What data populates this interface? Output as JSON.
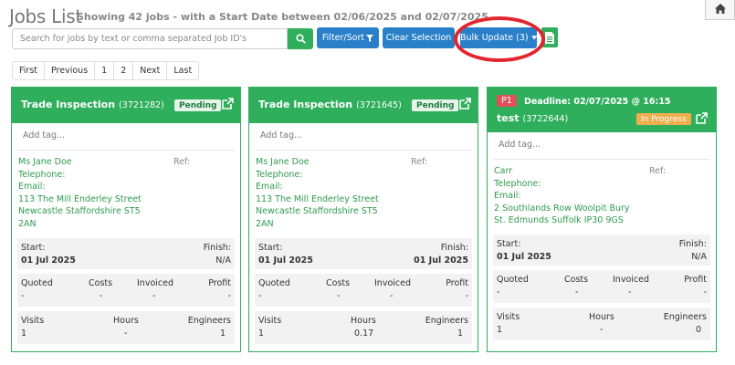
{
  "header": {
    "title": "Jobs List",
    "subtitle": "Showing 42 jobs - with a Start Date between 02/06/2025 and 02/07/2025"
  },
  "toolbar": {
    "search_placeholder": "Search for jobs by text or comma separated Job ID's",
    "search_value": "",
    "filter_label": "Filter/Sort",
    "clear_label": "Clear Selection",
    "bulk_label": "Bulk Update (3)"
  },
  "pagination": {
    "first": "First",
    "previous": "Previous",
    "page1": "1",
    "page2": "2",
    "next": "Next",
    "last": "Last"
  },
  "colors": {
    "green": "#2fae5c",
    "blue": "#2a80c8",
    "annotation_red": "#e3262e",
    "in_progress": "#f0ad4e",
    "priority_red": "#e0505a"
  },
  "cards": [
    {
      "title": "Trade Inspection",
      "job_id": "(3721282)",
      "status": "Pending",
      "tag_placeholder": "Add tag...",
      "contact": [
        "Ms Jane Doe",
        "Telephone:",
        "Email:",
        "113 The Mill Enderley Street",
        "Newcastle Staffordshire ST5",
        "2AN"
      ],
      "ref_label": "Ref:",
      "start_label": "Start:",
      "start_value": "01 Jul 2025",
      "finish_label": "Finish:",
      "finish_value": "N/A",
      "quoted_label": "Quoted",
      "quoted": "-",
      "costs_label": "Costs",
      "costs": "-",
      "invoiced_label": "Invoiced",
      "invoiced": "-",
      "profit_label": "Profit",
      "profit": "-",
      "visits_label": "Visits",
      "visits": "1",
      "hours_label": "Hours",
      "hours": "-",
      "engineers_label": "Engineers",
      "engineers": "1"
    },
    {
      "title": "Trade Inspection",
      "job_id": "(3721645)",
      "status": "Pending",
      "tag_placeholder": "Add tag...",
      "contact": [
        "Ms Jane Doe",
        "Telephone:",
        "Email:",
        "113 The Mill Enderley Street",
        "Newcastle Staffordshire ST5",
        "2AN"
      ],
      "ref_label": "Ref:",
      "start_label": "Start:",
      "start_value": "01 Jul 2025",
      "finish_label": "Finish:",
      "finish_value": "01 Jul 2025",
      "quoted_label": "Quoted",
      "quoted": "-",
      "costs_label": "Costs",
      "costs": "-",
      "invoiced_label": "Invoiced",
      "invoiced": "-",
      "profit_label": "Profit",
      "profit": "-",
      "visits_label": "Visits",
      "visits": "1",
      "hours_label": "Hours",
      "hours": "0.17",
      "engineers_label": "Engineers",
      "engineers": "1"
    },
    {
      "priority": "P1",
      "deadline": "Deadline: 02/07/2025 @ 16:15",
      "title": "test",
      "job_id": "(3722644)",
      "status": "In Progress",
      "tag_placeholder": "Add tag...",
      "contact": [
        "Carr",
        "Telephone:",
        "Email:",
        "2 Southlands Row Woolpit Bury",
        "St. Edmunds Suffolk IP30 9GS"
      ],
      "ref_label": "Ref:",
      "start_label": "Start:",
      "start_value": "01 Jul 2025",
      "finish_label": "Finish:",
      "finish_value": "N/A",
      "quoted_label": "Quoted",
      "quoted": "-",
      "costs_label": "Costs",
      "costs": "-",
      "invoiced_label": "Invoiced",
      "invoiced": "-",
      "profit_label": "Profit",
      "profit": "-",
      "visits_label": "Visits",
      "visits": "1",
      "hours_label": "Hours",
      "hours": "-",
      "engineers_label": "Engineers",
      "engineers": "0"
    }
  ]
}
